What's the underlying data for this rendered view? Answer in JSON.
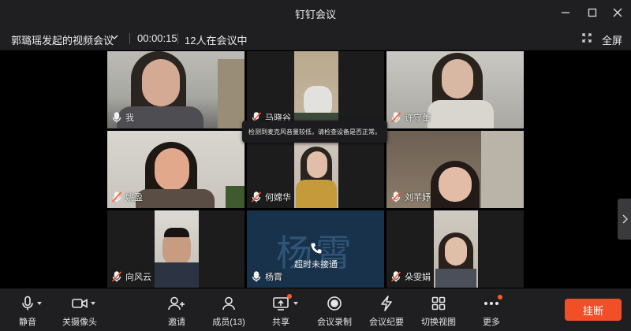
{
  "window": {
    "title": "钉钉会议"
  },
  "infobar": {
    "meeting_title": "郭璐瑶发起的视频会议",
    "timer": "00:00:15",
    "participants_count": "12人在会议中",
    "fullscreen_label": "全屏"
  },
  "tooltip": "检测到麦克风音量较低，请检查设备是否正常。",
  "tiles": [
    {
      "name": "我",
      "mic": "on"
    },
    {
      "name": "马晓谷",
      "mic": "muted"
    },
    {
      "name": "许守蕾",
      "mic": "muted"
    },
    {
      "name": "姚盈",
      "mic": "muted"
    },
    {
      "name": "何嫦华",
      "mic": "muted"
    },
    {
      "name": "刘芊妤",
      "mic": "muted"
    },
    {
      "name": "向风云",
      "mic": "muted"
    },
    {
      "name": "杨霄",
      "mic": "on",
      "avatar_text": "杨霄",
      "status": "超时未接通"
    },
    {
      "name": "朵雯娟",
      "mic": "muted"
    }
  ],
  "toolbar": {
    "mute": "静音",
    "camera_off": "关摄像头",
    "invite": "邀请",
    "members": "成员(13)",
    "share": "共享",
    "record": "会议录制",
    "minutes": "会议纪要",
    "switch_view": "切换视图",
    "more": "更多",
    "hangup": "挂断"
  },
  "colors": {
    "hangup": "#f04f28",
    "accent_dot": "#ff5a2c",
    "muted_slash": "#ff5a2c"
  }
}
